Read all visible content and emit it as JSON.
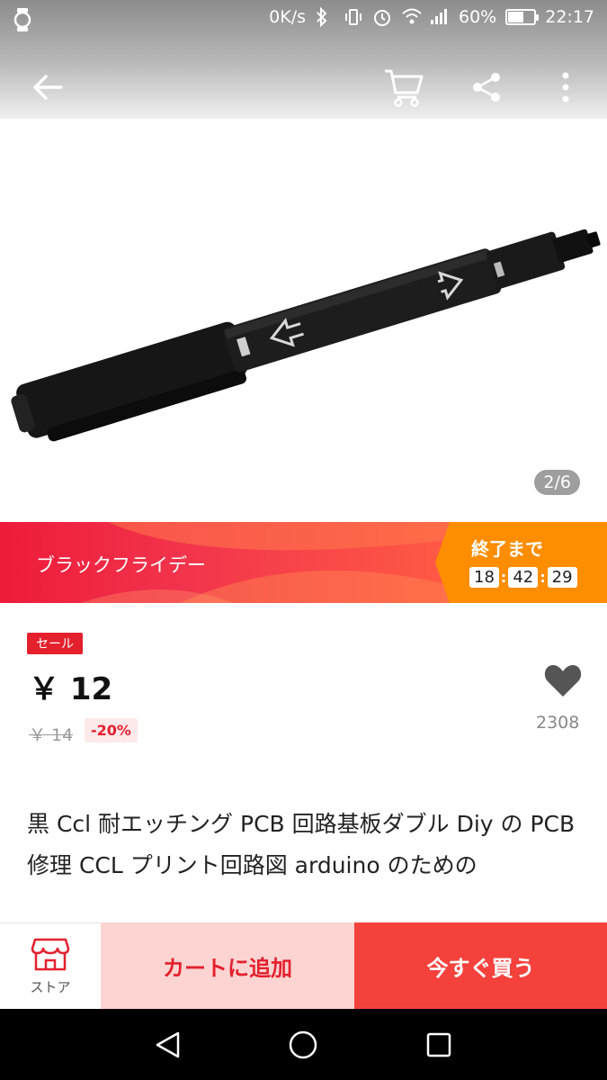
{
  "status_bar": {
    "speed": "0K/s",
    "battery": "60%",
    "battery_level": 0.6,
    "time": "22:17"
  },
  "nav": {
    "back": "arrow-left-icon",
    "cart": "cart-icon",
    "share": "share-icon",
    "more": "more-vertical-icon"
  },
  "gallery": {
    "counter": "2/6"
  },
  "banner": {
    "title": "ブラックフライデー",
    "ends_label": "終了まで",
    "countdown": {
      "hours": "18",
      "minutes": "42",
      "seconds": "29"
    }
  },
  "product": {
    "badge": "セール",
    "price": "￥ 12",
    "original_price": "￥ 14",
    "discount": "-20%",
    "wishlist_count": "2308",
    "title": "黒 Ccl 耐エッチング PCB 回路基板ダブル Diy の PCB 修理 CCL プリント回路図 arduino のための"
  },
  "actions": {
    "store_label": "ストア",
    "add_to_cart": "カートに追加",
    "buy_now": "今すぐ買う"
  },
  "colors": {
    "accent_red": "#e4202d",
    "banner_orange": "#ff8d00",
    "buy_red": "#f5413c",
    "cart_pink": "#fdd4d2"
  }
}
